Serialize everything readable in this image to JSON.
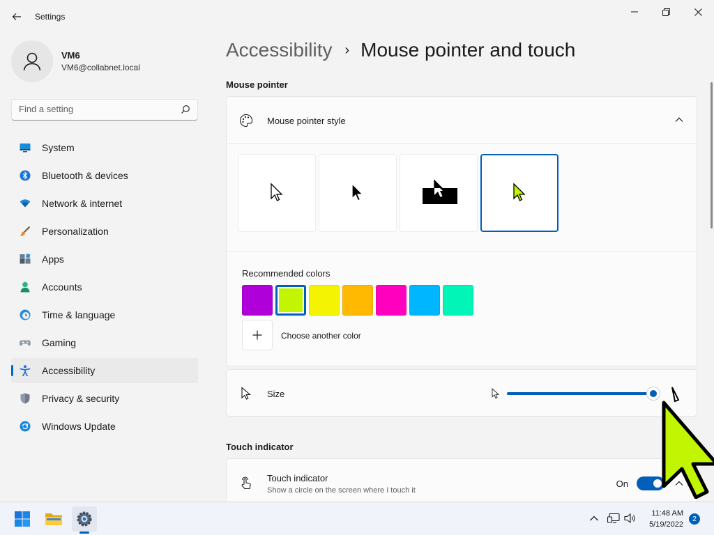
{
  "window": {
    "title": "Settings",
    "controls": [
      "minimize",
      "maximize",
      "close"
    ]
  },
  "profile": {
    "name": "VM6",
    "email": "VM6@collabnet.local"
  },
  "search": {
    "placeholder": "Find a setting"
  },
  "sidebar": {
    "items": [
      {
        "label": "System",
        "icon": "monitor-icon"
      },
      {
        "label": "Bluetooth & devices",
        "icon": "bluetooth-icon"
      },
      {
        "label": "Network & internet",
        "icon": "wifi-icon"
      },
      {
        "label": "Personalization",
        "icon": "brush-icon"
      },
      {
        "label": "Apps",
        "icon": "apps-icon"
      },
      {
        "label": "Accounts",
        "icon": "person-icon"
      },
      {
        "label": "Time & language",
        "icon": "clock-globe-icon"
      },
      {
        "label": "Gaming",
        "icon": "gamepad-icon"
      },
      {
        "label": "Accessibility",
        "icon": "accessibility-icon",
        "active": true
      },
      {
        "label": "Privacy & security",
        "icon": "shield-icon"
      },
      {
        "label": "Windows Update",
        "icon": "refresh-icon"
      }
    ]
  },
  "breadcrumb": {
    "parent": "Accessibility",
    "separator": "›",
    "current": "Mouse pointer and touch"
  },
  "mouse_pointer": {
    "section_title": "Mouse pointer",
    "style_label": "Mouse pointer style",
    "styles": [
      "white",
      "black",
      "inverted",
      "custom"
    ],
    "selected_style": "custom",
    "recommended_colors_label": "Recommended colors",
    "colors": [
      "#b000d9",
      "#c2f501",
      "#f4f301",
      "#ffb900",
      "#ff00bf",
      "#00b7ff",
      "#00f5b6"
    ],
    "selected_color": "#c2f501",
    "choose_another_label": "Choose another color",
    "size_label": "Size",
    "size_level": 1.0
  },
  "touch": {
    "section_title": "Touch indicator",
    "title": "Touch indicator",
    "description": "Show a circle on the screen where I touch it",
    "state_label": "On",
    "enabled": true
  },
  "taskbar": {
    "time": "11:48 AM",
    "date": "5/19/2022",
    "notifications": "2"
  },
  "colors": {
    "accent": "#005fb8",
    "cursor_color": "#c2f501"
  }
}
